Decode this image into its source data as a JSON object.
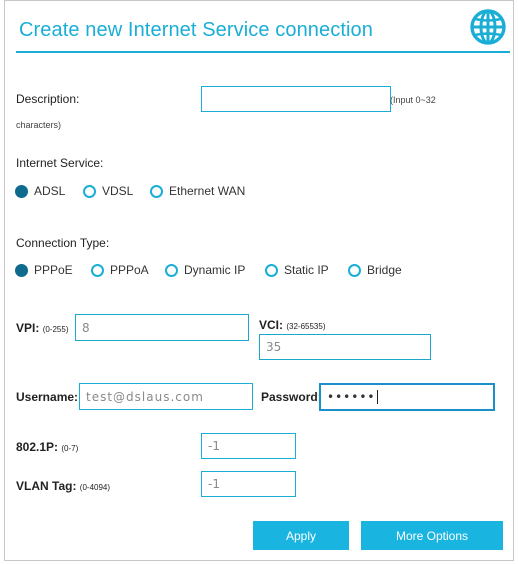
{
  "title": "Create new Internet Service connection",
  "description": {
    "label": "Description:",
    "value": "",
    "hint": "(Input 0~32",
    "hint2": "characters)"
  },
  "internet_service": {
    "label": "Internet Service:",
    "options": [
      {
        "label": "ADSL",
        "selected": true
      },
      {
        "label": "VDSL",
        "selected": false
      },
      {
        "label": "Ethernet WAN",
        "selected": false
      }
    ]
  },
  "connection_type": {
    "label": "Connection Type:",
    "options": [
      {
        "label": "PPPoE",
        "selected": true
      },
      {
        "label": "PPPoA",
        "selected": false
      },
      {
        "label": "Dynamic IP",
        "selected": false
      },
      {
        "label": "Static IP",
        "selected": false
      },
      {
        "label": "Bridge",
        "selected": false
      }
    ]
  },
  "vpi": {
    "label": "VPI:",
    "range": "(0-255)",
    "value": "8"
  },
  "vci": {
    "label": "VCI:",
    "range": "(32-65535)",
    "value": "35"
  },
  "username": {
    "label": "Username:",
    "value": "test@dslaus.com"
  },
  "password": {
    "label": "Password:",
    "value": "••••••"
  },
  "dot1p": {
    "label": "802.1P:",
    "range": "(0-7)",
    "value": "-1"
  },
  "vlan": {
    "label": "VLAN Tag:",
    "range": "(0-4094)",
    "value": "-1"
  },
  "buttons": {
    "apply": "Apply",
    "more": "More Options"
  },
  "colors": {
    "accent": "#1aaed6",
    "selected_radio": "#0f6b8d",
    "button": "#19b4e0"
  }
}
